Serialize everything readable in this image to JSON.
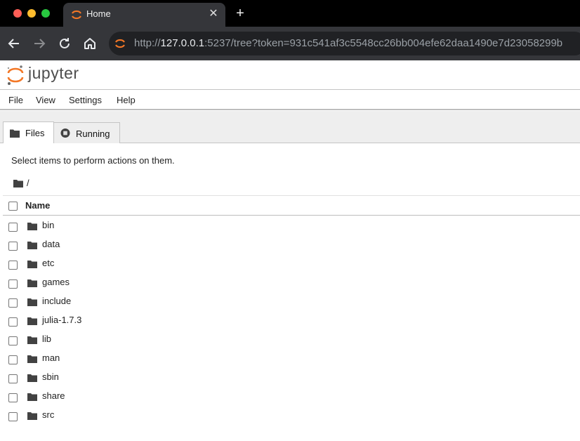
{
  "browser": {
    "tab_title": "Home",
    "tab_close": "✕",
    "new_tab": "+",
    "url_prefix": "http://",
    "url_host": "127.0.0.1",
    "url_rest": ":5237/tree?token=931c541af3c5548cc26bb004efe62daa1490e7d23058299b"
  },
  "app": {
    "logo_text": "jupyter"
  },
  "menu": {
    "file": "File",
    "view": "View",
    "settings": "Settings",
    "help": "Help"
  },
  "tabs": {
    "files": "Files",
    "running": "Running"
  },
  "file_browser": {
    "hint": "Select items to perform actions on them.",
    "breadcrumb": "/",
    "name_column": "Name",
    "items": [
      {
        "name": "bin"
      },
      {
        "name": "data"
      },
      {
        "name": "etc"
      },
      {
        "name": "games"
      },
      {
        "name": "include"
      },
      {
        "name": "julia-1.7.3"
      },
      {
        "name": "lib"
      },
      {
        "name": "man"
      },
      {
        "name": "sbin"
      },
      {
        "name": "share"
      },
      {
        "name": "src"
      }
    ]
  },
  "colors": {
    "jupyter_orange": "#f37726",
    "chrome_dark": "#35363a"
  }
}
